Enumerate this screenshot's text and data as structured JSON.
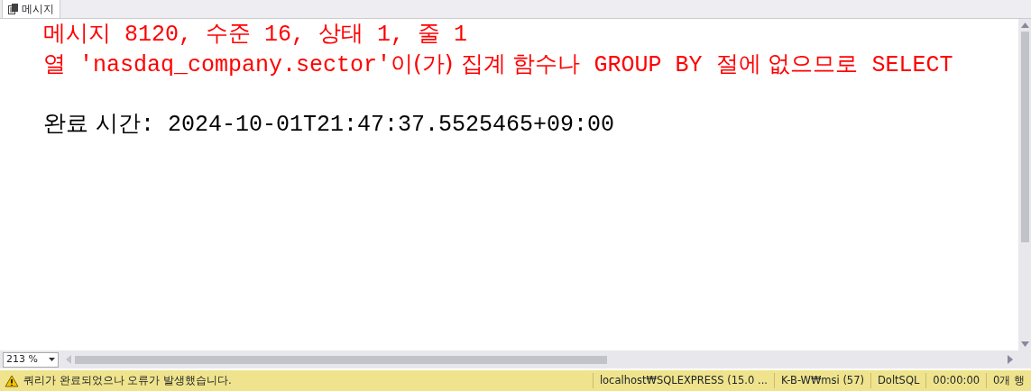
{
  "tabs": [
    {
      "label": "메시지",
      "selected": true
    }
  ],
  "messages": [
    {
      "kind": "error",
      "parts": [
        "메시지",
        " 8120, ",
        "수준",
        " 16, ",
        "상태",
        " 1, ",
        "줄",
        " 1"
      ]
    },
    {
      "kind": "error",
      "parts": [
        "열",
        " 'nasdaq_company.sector'",
        "이(가) 집계 함수나",
        " GROUP BY ",
        "절에 없으므로",
        " SELECT"
      ]
    },
    {
      "kind": "blank"
    },
    {
      "kind": "info",
      "parts": [
        "완료 시간",
        ": 2024-10-01T21:47:37.5525465+09:00"
      ]
    }
  ],
  "zoom": "213 %",
  "status_bar": {
    "message": "쿼리가 완료되었으나 오류가 발생했습니다.",
    "segments": [
      "localhost₩SQLEXPRESS (15.0 ...",
      "K-B-W₩msi (57)",
      "DoltSQL",
      "00:00:00",
      "0개 행"
    ]
  }
}
